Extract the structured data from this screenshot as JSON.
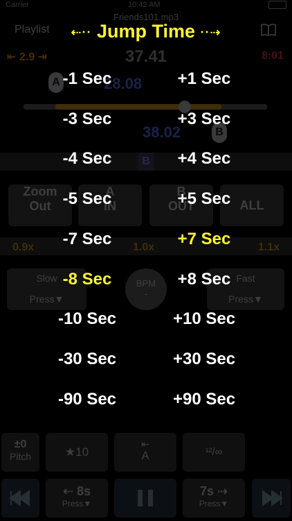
{
  "status_bar": {
    "carrier": "Carrier",
    "time": "10:42 AM"
  },
  "background": {
    "filename": "Friends101.mp3",
    "playlist_label": "Playlist",
    "loop_start_value": "2.9",
    "current_time": "37.41",
    "end_time": "8:01",
    "a_point_time": "28.08",
    "b_point_time": "38.02",
    "marker_a": "A",
    "marker_b": "B",
    "strip_label": "B",
    "buttons_row": [
      {
        "line1": "Zoom",
        "line2": "Out"
      },
      {
        "line1": "A",
        "line2": "IN"
      },
      {
        "line1": "B",
        "line2": "OUT"
      },
      {
        "line1": "ALL",
        "line2": ""
      }
    ],
    "speed_low": "0.9x",
    "speed_current": "1.0x",
    "speed_high": "1.1x",
    "slow_button": {
      "label": "Slow",
      "sub": "Press▼"
    },
    "fast_button": {
      "label": "Fast",
      "sub": "Press▼"
    },
    "bpm": {
      "label": "BPM",
      "value": "-"
    },
    "bottom_row1": [
      {
        "line1": "±0",
        "line2": "Pitch"
      },
      {
        "line1": "★10",
        "line2": ""
      },
      {
        "line1": "⇤",
        "line2": "A"
      },
      {
        "line1": "¹²/∞",
        "line2": ""
      }
    ],
    "bottom_row2": {
      "back_label": "⇠ 8s",
      "back_sub": "Press▼",
      "fwd_label": "7s ⇢",
      "fwd_sub": "Press▼"
    }
  },
  "dialog": {
    "title": "Jump Time",
    "title_left_decor": "⇠··",
    "title_right_decor": "··⇢",
    "left_column": [
      "-1 Sec",
      "-3 Sec",
      "-4 Sec",
      "-5 Sec",
      "-7 Sec",
      "-8 Sec",
      "-10 Sec",
      "-30 Sec",
      "-90 Sec"
    ],
    "right_column": [
      "+1 Sec",
      "+3 Sec",
      "+4 Sec",
      "+5 Sec",
      "+7 Sec",
      "+8 Sec",
      "+10 Sec",
      "+30 Sec",
      "+90 Sec"
    ],
    "selected_left": "-8 Sec",
    "selected_right": "+7 Sec",
    "highlight_color": "#fff533"
  }
}
